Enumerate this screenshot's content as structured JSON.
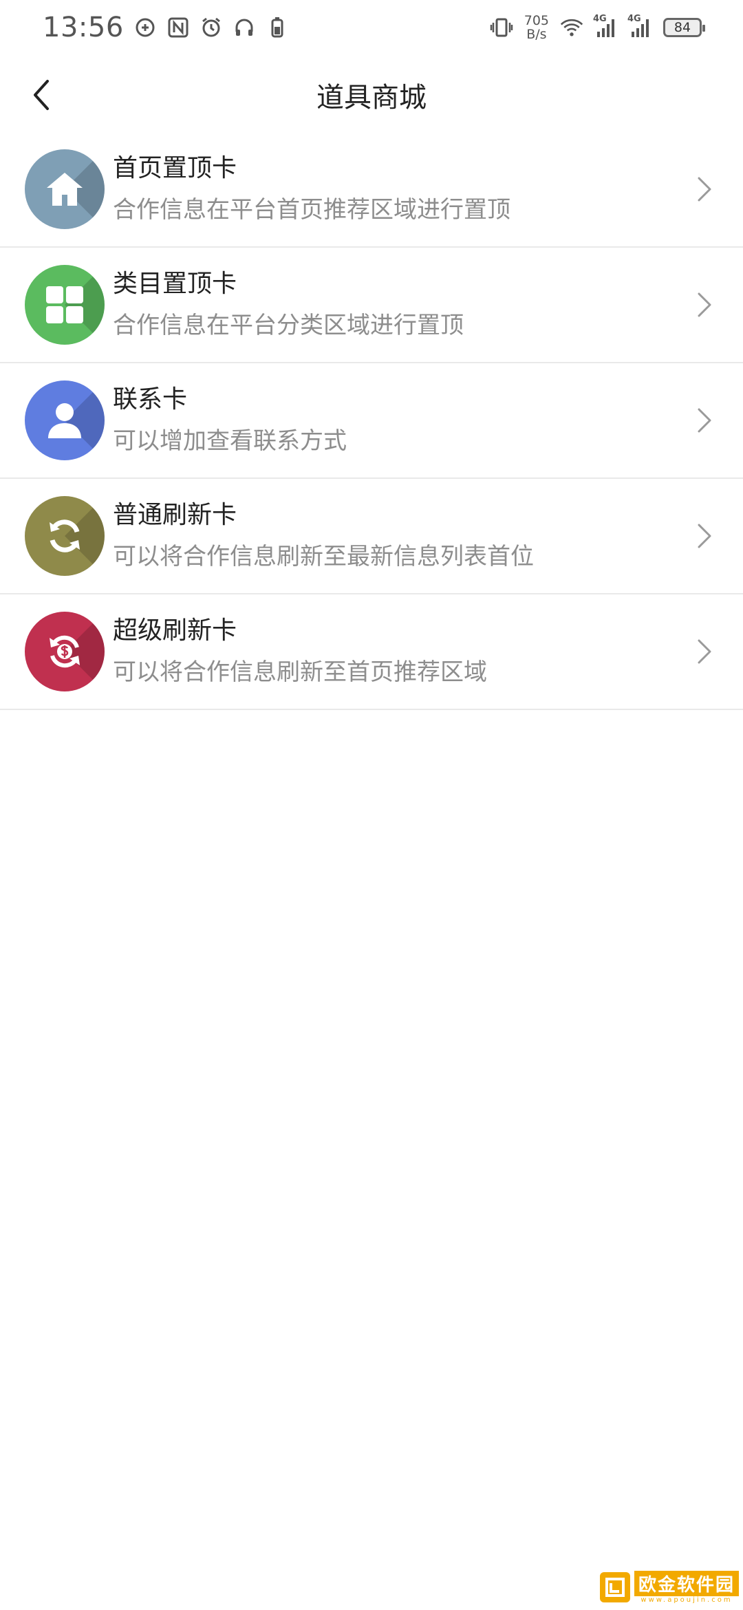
{
  "status_bar": {
    "time": "13:56",
    "speed_value": "705",
    "speed_unit": "B/s",
    "net1": "4G",
    "net2": "4G",
    "battery": "84"
  },
  "header": {
    "title": "道具商城",
    "back_icon": "chevron-left-icon"
  },
  "items": [
    {
      "title": "首页置顶卡",
      "desc": "合作信息在平台首页推荐区域进行置顶",
      "icon": "home-icon",
      "color": "#7f9fb5"
    },
    {
      "title": "类目置顶卡",
      "desc": "合作信息在平台分类区域进行置顶",
      "icon": "grid-icon",
      "color": "#5bbb5f"
    },
    {
      "title": "联系卡",
      "desc": "可以增加查看联系方式",
      "icon": "user-icon",
      "color": "#5f7de0"
    },
    {
      "title": "普通刷新卡",
      "desc": "可以将合作信息刷新至最新信息列表首位",
      "icon": "refresh-icon",
      "color": "#8f8a4a"
    },
    {
      "title": "超级刷新卡",
      "desc": "可以将合作信息刷新至首页推荐区域",
      "icon": "refresh-dollar-icon",
      "color": "#c0304f"
    }
  ],
  "watermark": {
    "main": "欧金软件园",
    "sub": "www.apoujin.com"
  }
}
